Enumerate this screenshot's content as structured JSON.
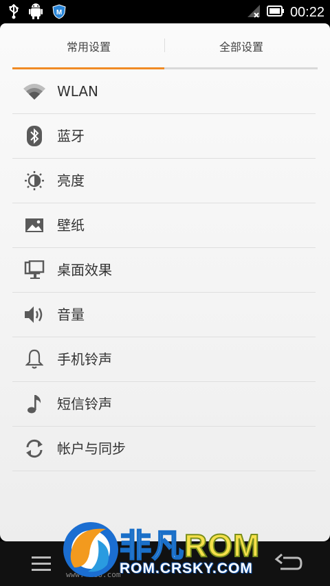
{
  "status_bar": {
    "time": "00:22",
    "icons": [
      "usb-icon",
      "android-debug-icon",
      "security-shield-icon",
      "signal-icon",
      "battery-icon"
    ]
  },
  "tabs": [
    {
      "label": "常用设置",
      "active": true
    },
    {
      "label": "全部设置",
      "active": false
    }
  ],
  "settings": [
    {
      "label": "WLAN",
      "icon": "wifi-icon"
    },
    {
      "label": "蓝牙",
      "icon": "bluetooth-icon"
    },
    {
      "label": "亮度",
      "icon": "brightness-icon"
    },
    {
      "label": "壁纸",
      "icon": "wallpaper-icon"
    },
    {
      "label": "桌面效果",
      "icon": "desktop-effect-icon"
    },
    {
      "label": "音量",
      "icon": "volume-icon"
    },
    {
      "label": "手机铃声",
      "icon": "bell-icon"
    },
    {
      "label": "短信铃声",
      "icon": "music-note-icon"
    },
    {
      "label": "帐户与同步",
      "icon": "sync-icon"
    }
  ],
  "watermark": {
    "brand_cn": "非凡",
    "brand_rom": "ROM",
    "site": "ROM.CRSKY.COM",
    "url_partial": "www.    ndo.com"
  },
  "colors": {
    "accent": "#f08a24",
    "icon_gray": "#5a5a5a"
  }
}
